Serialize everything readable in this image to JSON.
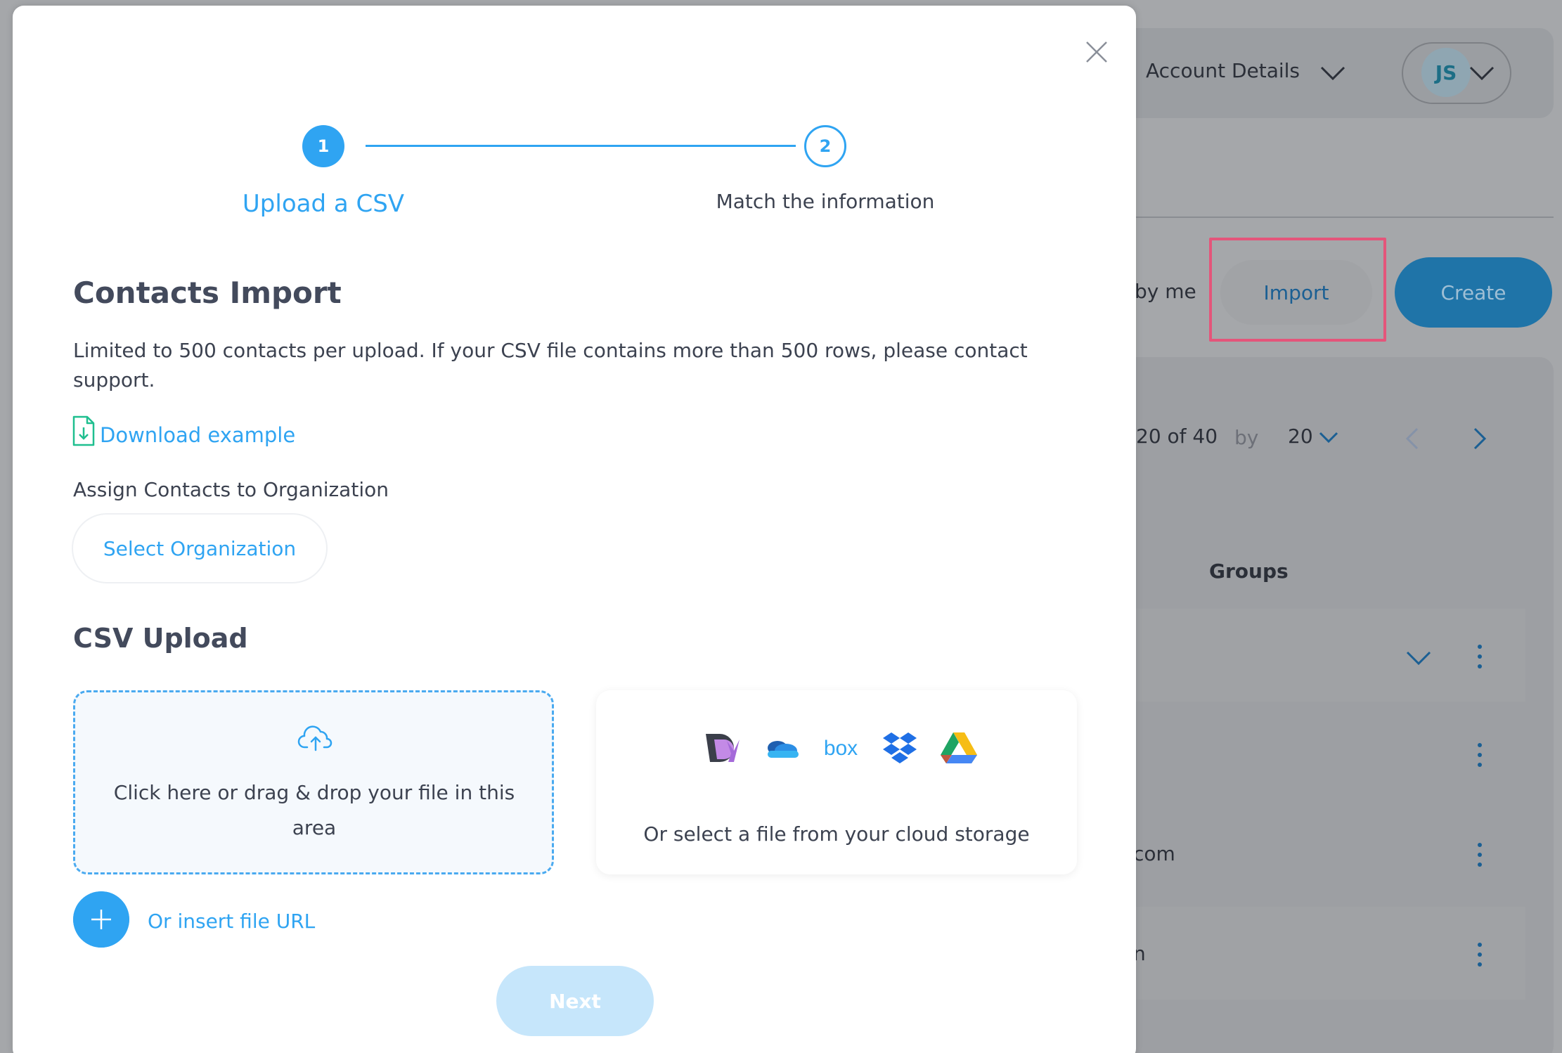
{
  "background": {
    "account_label": "Account Details",
    "user_initials": "JS",
    "filter_partial": "by me",
    "import_label": "Import",
    "create_label": "Create",
    "pager_count": "20 of 40",
    "pager_by": "by",
    "pager_per_page": "20",
    "groups_header": "Groups",
    "rows": [
      {
        "text": ""
      },
      {
        "text": ""
      },
      {
        "text": "com"
      },
      {
        "text": "n"
      }
    ],
    "colors": {
      "highlight": "#e4557a",
      "create": "#1f74a8"
    }
  },
  "modal": {
    "steps": [
      {
        "number": "1",
        "label": "Upload a CSV",
        "active": true
      },
      {
        "number": "2",
        "label": "Match the information",
        "active": false
      }
    ],
    "title": "Contacts Import",
    "description": "Limited to 500 contacts per upload. If your CSV file contains more than 500 rows, please contact support.",
    "download_label": "Download example",
    "assign_label": "Assign Contacts to Organization",
    "select_org_label": "Select Organization",
    "csv_title": "CSV Upload",
    "dropzone_text": "Click here or drag & drop your file in this area",
    "cloud_icons": [
      "dubsado-icon",
      "onedrive-icon",
      "box-icon",
      "dropbox-icon",
      "google-drive-icon"
    ],
    "box_logo_text": "box",
    "cloud_text": "Or select a file from your cloud storage",
    "url_label": "Or insert file URL",
    "next_label": "Next",
    "colors": {
      "accent": "#2fa4f2",
      "next_disabled": "#c6e6fb"
    }
  }
}
